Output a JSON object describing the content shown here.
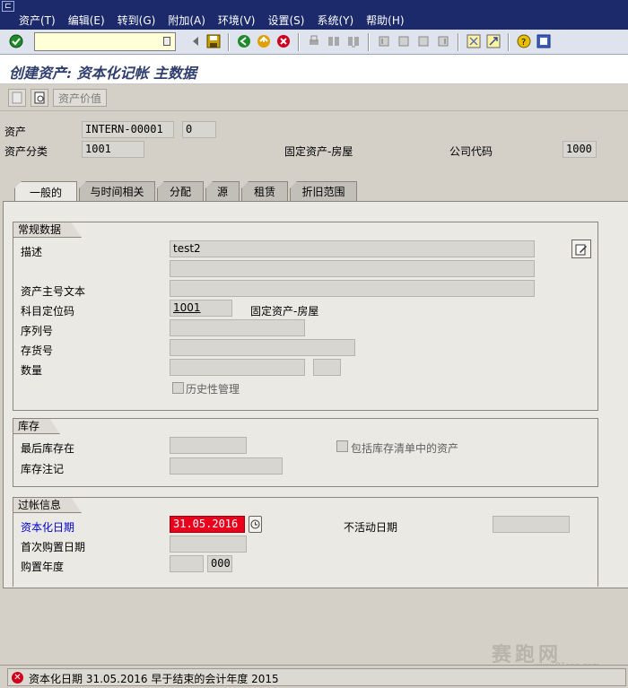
{
  "menubar": {
    "items": [
      "资产(T)",
      "编辑(E)",
      "转到(G)",
      "附加(A)",
      "环境(V)",
      "设置(S)",
      "系统(Y)",
      "帮助(H)"
    ]
  },
  "toolbar": {
    "command_field_value": ""
  },
  "title": "创建资产: 资本化记帐 主数据",
  "app_toolbar": {
    "asset_value_button": "资产价值"
  },
  "header": {
    "asset_label": "资产",
    "asset_number": "INTERN-00001",
    "asset_subnumber": "0",
    "asset_class_label": "资产分类",
    "asset_class_value": "1001",
    "asset_class_text": "固定资产-房屋",
    "company_code_label": "公司代码",
    "company_code_value": "1000"
  },
  "tabs": [
    "一般的",
    "与时间相关",
    "分配",
    "源",
    "租赁",
    "折旧范围"
  ],
  "general_data": {
    "title": "常规数据",
    "description_label": "描述",
    "description_value": "test2",
    "description2_value": "",
    "main_text_label": "资产主号文本",
    "main_text_value": "",
    "acct_determination_label": "科目定位码",
    "acct_determination_value": "1001",
    "acct_determination_text": "固定资产-房屋",
    "serial_label": "序列号",
    "serial_value": "",
    "inventory_label": "存货号",
    "inventory_value": "",
    "quantity_label": "数量",
    "quantity_value": "",
    "quantity_unit": "",
    "history_label": "历史性管理"
  },
  "inventory": {
    "title": "库存",
    "last_inventory_label": "最后库存在",
    "last_inventory_value": "",
    "include_label": "包括库存清单中的资产",
    "inventory_note_label": "库存注记",
    "inventory_note_value": ""
  },
  "posting_info": {
    "title": "过帐信息",
    "cap_date_label": "资本化日期",
    "cap_date_value": "31.05.2016",
    "deactivation_label": "不活动日期",
    "deactivation_value": "",
    "first_acq_label": "首次购置日期",
    "first_acq_value": "",
    "acq_year_label": "购置年度",
    "acq_year_value": "",
    "acq_period_value": "000"
  },
  "status": {
    "message": "资本化日期 31.05.2016 早于结束的会计年度 2015"
  },
  "watermark": {
    "text": "赛跑网",
    "url": "www.91sap.com"
  },
  "colors": {
    "menubar_bg": "#1c2a6b",
    "error_red": "#e8001c",
    "link_blue": "#0000cc"
  }
}
